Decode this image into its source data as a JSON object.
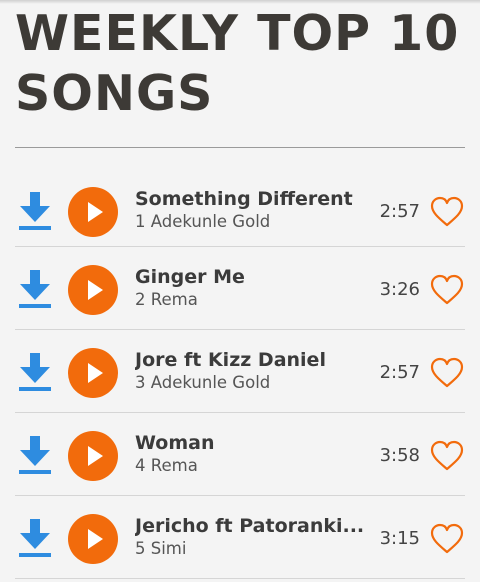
{
  "page": {
    "title": "WEEKLY TOP 10 SONGS"
  },
  "colors": {
    "accent": "#f26b0c",
    "download": "#2e8ce0",
    "background": "#f4f4f4"
  },
  "icons": {
    "download": "download-icon",
    "play": "play-icon",
    "favorite": "heart-icon"
  },
  "songs": [
    {
      "title": "Something Different",
      "artist": "1 Adekunle Gold",
      "duration": "2:57"
    },
    {
      "title": "Ginger Me",
      "artist": "2 Rema",
      "duration": "3:26"
    },
    {
      "title": "Jore ft Kizz Daniel",
      "artist": "3 Adekunle Gold",
      "duration": "2:57"
    },
    {
      "title": "Woman",
      "artist": "4 Rema",
      "duration": "3:58"
    },
    {
      "title": "Jericho ft Patoranki...",
      "artist": "5 Simi",
      "duration": "3:15"
    }
  ]
}
